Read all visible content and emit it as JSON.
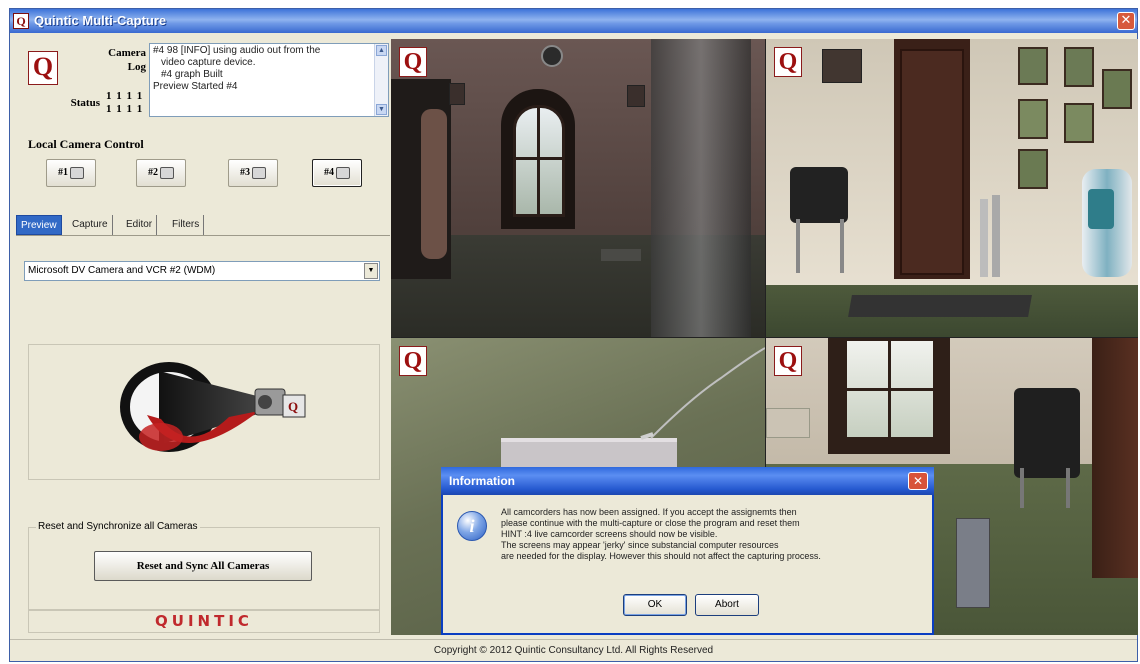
{
  "window": {
    "title": "Quintic Multi-Capture",
    "close_glyph": "✕",
    "logo_letter": "Q"
  },
  "left_panel": {
    "camera_label": "Camera",
    "log_label": "Log",
    "status_label": "Status",
    "status_row1": "1 1 1 1",
    "status_row2": "1 1 1 1",
    "log_lines": [
      "#4 98 [INFO] using audio out from the",
      "video capture device.",
      "#4 graph Built",
      "Preview Started #4"
    ],
    "local_camera_control_label": "Local Camera Control",
    "camera_buttons": [
      {
        "label": "#1",
        "selected": false
      },
      {
        "label": "#2",
        "selected": false
      },
      {
        "label": "#3",
        "selected": false
      },
      {
        "label": "#4",
        "selected": true
      }
    ],
    "tabs": [
      {
        "label": "Preview",
        "active": true
      },
      {
        "label": "Capture",
        "active": false
      },
      {
        "label": "Editor",
        "active": false
      },
      {
        "label": "Filters",
        "active": false
      }
    ],
    "camera_select_value": "Microsoft DV Camera and VCR #2 (WDM)",
    "reset_group_label": "Reset and Synchronize all Cameras",
    "reset_button_label": "Reset and Sync All Cameras",
    "brand_text": "QUINTIC"
  },
  "camera_views": [
    {
      "id": "cam-view-1"
    },
    {
      "id": "cam-view-2"
    },
    {
      "id": "cam-view-3"
    },
    {
      "id": "cam-view-4"
    }
  ],
  "dialog": {
    "title": "Information",
    "message_lines": [
      "All camcorders has now been assigned. If you accept the assignemts then",
      "please continue with the multi-capture or close the program and reset them",
      "HINT :4 live camcorder screens should now be visible.",
      "The screens may appear 'jerky' since substancial computer resources",
      "are needed for the display. However this should not affect the capturing process."
    ],
    "ok_label": "OK",
    "abort_label": "Abort"
  },
  "footer": {
    "copyright": "Copyright © 2012 Quintic Consultancy Ltd.  All Rights Reserved"
  },
  "colors": {
    "title_bar": "#3d73d9",
    "window_bg": "#ece9d8",
    "brand_red": "#c0292d",
    "dialog_border": "#0a3ec2"
  }
}
